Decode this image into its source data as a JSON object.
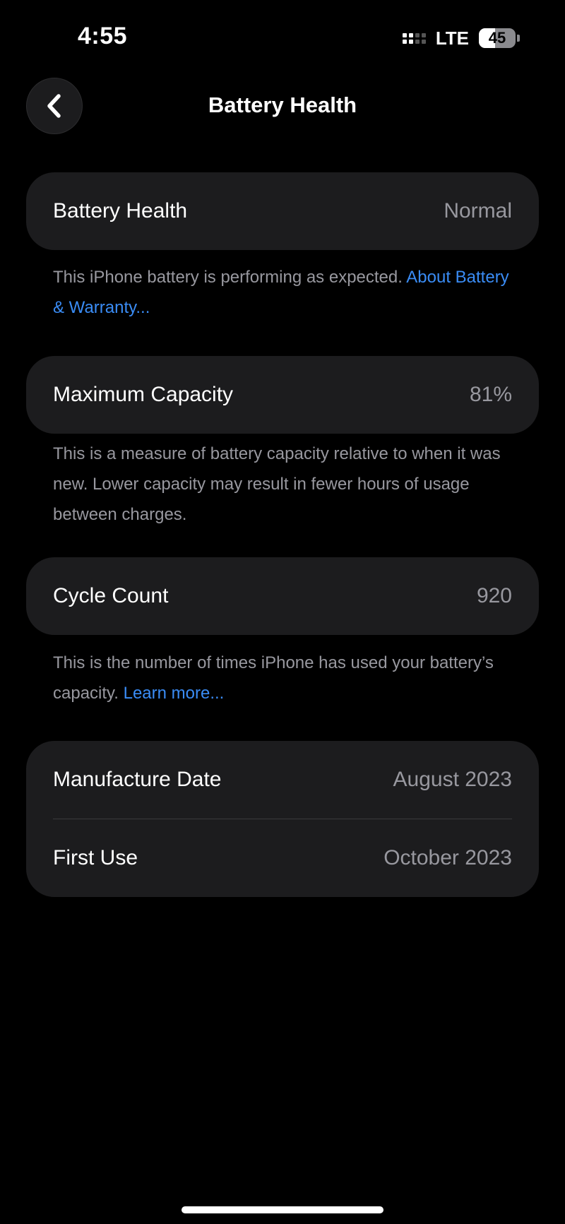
{
  "status_bar": {
    "time": "4:55",
    "network": "LTE",
    "battery_percent": "45",
    "battery_level": 0.45
  },
  "nav": {
    "title": "Battery Health",
    "back_icon": "chevron-left-icon"
  },
  "battery_health": {
    "label": "Battery Health",
    "value": "Normal",
    "note_text": "This iPhone battery is performing as expected. ",
    "note_link": "About Battery & Warranty..."
  },
  "maximum_capacity": {
    "label": "Maximum Capacity",
    "value": "81%",
    "note_text": "This is a measure of battery capacity relative to when it was new. Lower capacity may result in fewer hours of usage between charges."
  },
  "cycle_count": {
    "label": "Cycle Count",
    "value": "920",
    "note_text": "This is the number of times iPhone has used your battery’s capacity. ",
    "note_link": "Learn more..."
  },
  "dates": {
    "manufacture_label": "Manufacture Date",
    "manufacture_value": "August 2023",
    "first_use_label": "First Use",
    "first_use_value": "October 2023"
  },
  "colors": {
    "background": "#000000",
    "card": "#1c1c1e",
    "secondary_text": "#98989f",
    "link": "#3a8cf5"
  }
}
